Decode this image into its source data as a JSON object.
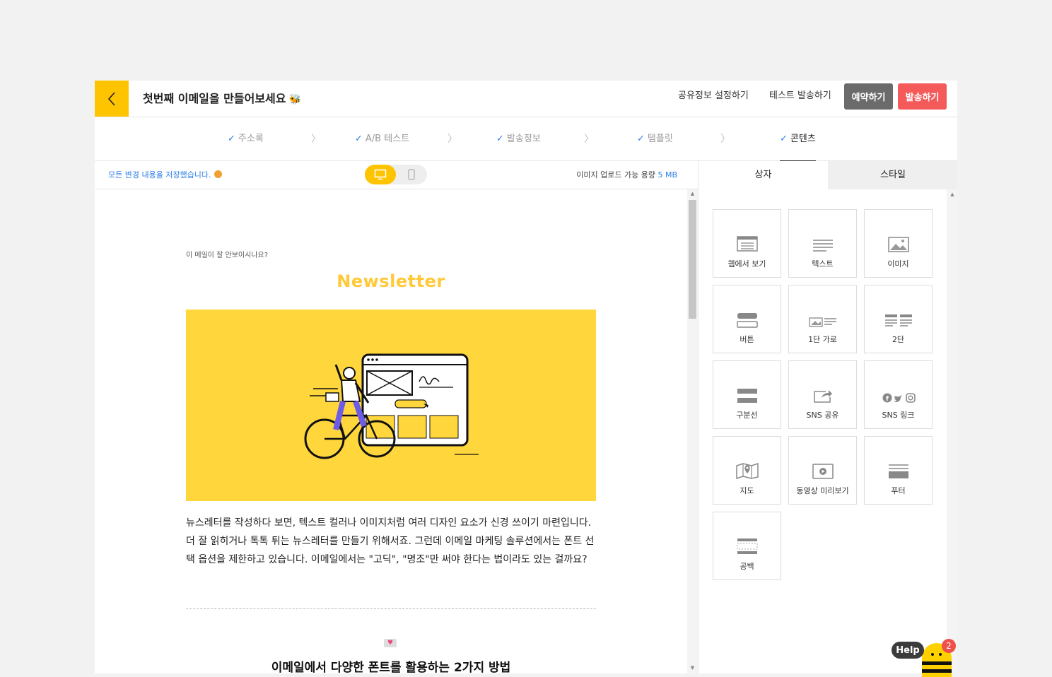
{
  "header": {
    "title": "첫번째 이메일을 만들어보세요",
    "share_settings": "공유정보 설정하기",
    "test_send": "테스트 발송하기",
    "reserve": "예약하기",
    "send": "발송하기"
  },
  "steps": [
    {
      "label": "주소록",
      "done": true
    },
    {
      "label": "A/B 테스트",
      "done": true
    },
    {
      "label": "발송정보",
      "done": true
    },
    {
      "label": "템플릿",
      "done": true
    },
    {
      "label": "콘텐츠",
      "done": true,
      "active": true
    }
  ],
  "toolbar": {
    "saved_message": "모든 변경 내용을 저장했습니다.",
    "upload_label": "이미지 업로드 가능 용량",
    "upload_capacity": "5 MB"
  },
  "email": {
    "preheader": "이 메일이 잘 안보이시나요?",
    "title": "Newsletter",
    "body": "뉴스레터를 작성하다 보면, 텍스트 컬러나 이미지처럼 여러 디자인 요소가 신경 쓰이기 마련입니다. 더 잘 읽히거나 톡톡 튀는 뉴스레터를 만들기 위해서죠. 그런데 이메일 마케팅 솔루션에서는 폰트 선택 옵션을 제한하고 있습니다. 이메일에서는 \"고딕\", \"명조\"만 써야 한다는 법이라도 있는 걸까요?",
    "subheading": "이메일에서 다양한 폰트를 활용하는 2가지 방법"
  },
  "panel": {
    "tabs": [
      "상자",
      "스타일"
    ],
    "blocks": [
      {
        "label": "웹에서 보기",
        "icon": "web-view-icon"
      },
      {
        "label": "텍스트",
        "icon": "text-icon"
      },
      {
        "label": "이미지",
        "icon": "image-icon"
      },
      {
        "label": "버튼",
        "icon": "button-icon"
      },
      {
        "label": "1단 가로",
        "icon": "one-column-horizontal-icon"
      },
      {
        "label": "2단",
        "icon": "two-column-icon"
      },
      {
        "label": "구분선",
        "icon": "divider-icon"
      },
      {
        "label": "SNS 공유",
        "icon": "share-icon"
      },
      {
        "label": "SNS 링크",
        "icon": "social-links-icon"
      },
      {
        "label": "지도",
        "icon": "map-icon"
      },
      {
        "label": "동영상 미리보기",
        "icon": "video-icon"
      },
      {
        "label": "푸터",
        "icon": "footer-icon"
      },
      {
        "label": "공백",
        "icon": "spacer-icon"
      }
    ]
  },
  "help": {
    "label": "Help",
    "badge": "2"
  },
  "colors": {
    "brand_yellow": "#ffc400",
    "send_red": "#f55a5a",
    "link_blue": "#2b7de9"
  }
}
